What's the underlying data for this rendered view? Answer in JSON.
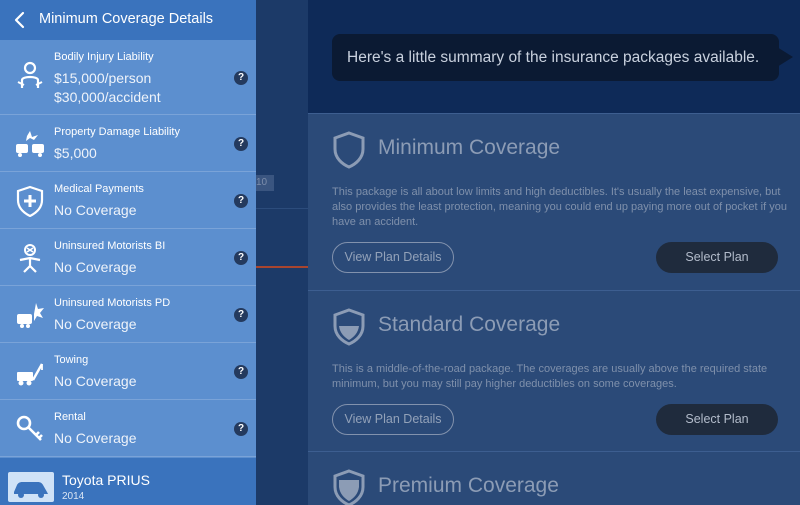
{
  "drawer": {
    "title": "Minimum Coverage Details",
    "back_icon": "chevron-left-icon",
    "items": [
      {
        "label": "Bodily Injury Liability",
        "value": "$15,000/person",
        "value2": "$30,000/accident",
        "icon": "injured-person-icon"
      },
      {
        "label": "Property Damage Liability",
        "value": "$5,000",
        "icon": "car-crash-icon"
      },
      {
        "label": "Medical Payments",
        "value": "No Coverage",
        "icon": "shield-plus-icon"
      },
      {
        "label": "Uninsured Motorists BI",
        "value": "No Coverage",
        "icon": "person-hit-icon"
      },
      {
        "label": "Uninsured Motorists PD",
        "value": "No Coverage",
        "icon": "car-damage-icon"
      },
      {
        "label": "Towing",
        "value": "No Coverage",
        "icon": "tow-truck-icon"
      },
      {
        "label": "Rental",
        "value": "No Coverage",
        "icon": "car-key-icon"
      }
    ],
    "help_label": "?",
    "vehicle": {
      "name": "Toyota PRIUS",
      "year": "2014",
      "icon": "car-icon"
    }
  },
  "main": {
    "bubble_text": "Here's a little summary of the insurance packages available.",
    "packages": [
      {
        "title": "Minimum Coverage",
        "description": "This package is all about low limits and high deductibles. It's usually the least expensive, but also provides the least protection, meaning you could end up paying more out of pocket if you have an accident.",
        "details_label": "View Plan Details",
        "select_label": "Select Plan",
        "icon": "shield-empty-icon"
      },
      {
        "title": "Standard Coverage",
        "description": "This is a middle-of-the-road package. The coverages are usually above the required state minimum, but you may still pay higher deductibles on some coverages.",
        "details_label": "View Plan Details",
        "select_label": "Select Plan",
        "icon": "shield-half-icon"
      },
      {
        "title": "Premium Coverage",
        "icon": "shield-full-icon"
      }
    ],
    "obscured_fragment": "10"
  },
  "colors": {
    "drawer_bg": "#5c8fcf",
    "drawer_header": "#3a73bd",
    "help_badge": "#243a5e",
    "select_button": "#1f2b3d",
    "accent_line": "#a8452f"
  }
}
